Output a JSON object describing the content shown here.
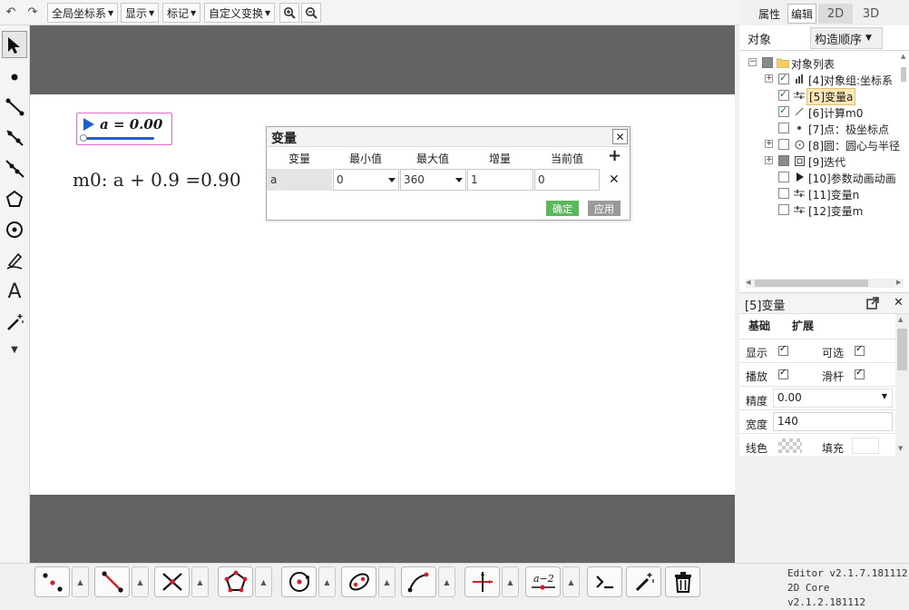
{
  "toolbar": {
    "menus": [
      "全局坐标系",
      "显示",
      "标记",
      "自定义变换"
    ]
  },
  "right_tabs": [
    "属性",
    "编辑",
    "2D",
    "3D"
  ],
  "panel_tabs": {
    "objects": "对象",
    "order": "构造顺序"
  },
  "tree": {
    "root": "对象列表",
    "items": [
      "[4]对象组:坐标系",
      "[5]变量a",
      "[6]计算m0",
      "[7]点：极坐标点",
      "[8]圆：圆心与半径",
      "[9]迭代",
      "[10]参数动画动画",
      "[11]变量n",
      "[12]变量m"
    ]
  },
  "canvas": {
    "slider_label": "a = 0.00",
    "calc_text": "m0: a + 0.9 =0.90"
  },
  "dialog": {
    "title": "变量",
    "columns": [
      "变量",
      "最小值",
      "最大值",
      "增量",
      "当前值"
    ],
    "row": {
      "name": "a",
      "min": "0",
      "max": "360",
      "step": "1",
      "current": "0"
    },
    "ok": "确定",
    "apply": "应用"
  },
  "properties": {
    "title": "[5]变量",
    "tabs": [
      "基础",
      "扩展"
    ],
    "show": "显示",
    "selectable": "可选",
    "play": "播放",
    "slider": "滑杆",
    "precision_label": "精度",
    "precision_value": "0.00",
    "width_label": "宽度",
    "width_value": "140",
    "line_color": "线色",
    "fill": "填充"
  },
  "version": {
    "editor": "Editor v2.1.7.181112",
    "core": "2D Core v2.1.2.181112"
  },
  "colors": {
    "canvas_border": "#636363",
    "slider_blue": "#2a60c0",
    "ok_green": "#5cb85c",
    "apply_gray": "#9a9a9a",
    "tree_highlight": "#fbe7b5"
  }
}
